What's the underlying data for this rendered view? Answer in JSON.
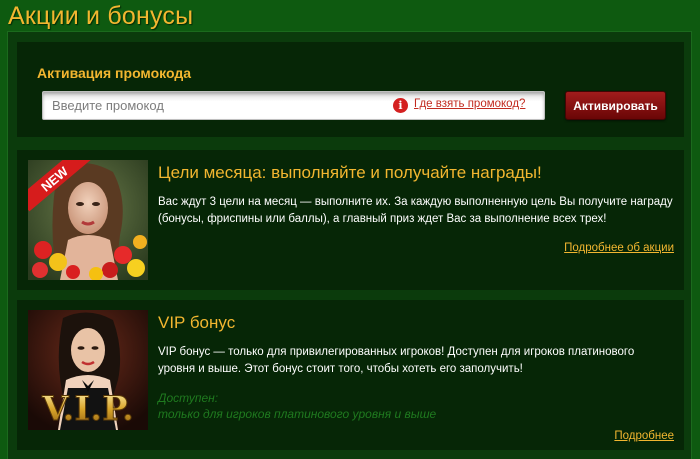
{
  "page": {
    "title": "Акции и бонусы"
  },
  "promo": {
    "heading": "Активация промокода",
    "input_placeholder": "Введите промокод",
    "help_link": "Где взять промокод?",
    "activate_label": "Активировать",
    "info_icon": "info-icon"
  },
  "cards": [
    {
      "title": "Цели месяца: выполняйте и получайте награды!",
      "description": "Вас ждут 3 цели на месяц — выполните их. За каждую выполненную цель Вы получите награду (бонусы, фриспины или баллы), а главный приз ждет Вас за выполнение всех трех!",
      "more_link": "Подробнее об акции",
      "badge": "NEW"
    },
    {
      "title": "VIP бонус",
      "description": "VIP бонус — только для привилегированных игроков! Доступен для игроков платинового уровня и выше. Этот бонус стоит того, чтобы хотеть его заполучить!",
      "availability_label": "Доступен:",
      "availability_text": "только для игроков платинового уровня и выше",
      "more_link": "Подробнее",
      "thumb_text": "V.I.P."
    }
  ],
  "colors": {
    "accent": "#f2b630",
    "background": "#0e5a10",
    "panel": "#062606",
    "button": "#8a1010",
    "link_red": "#c22a1f"
  }
}
